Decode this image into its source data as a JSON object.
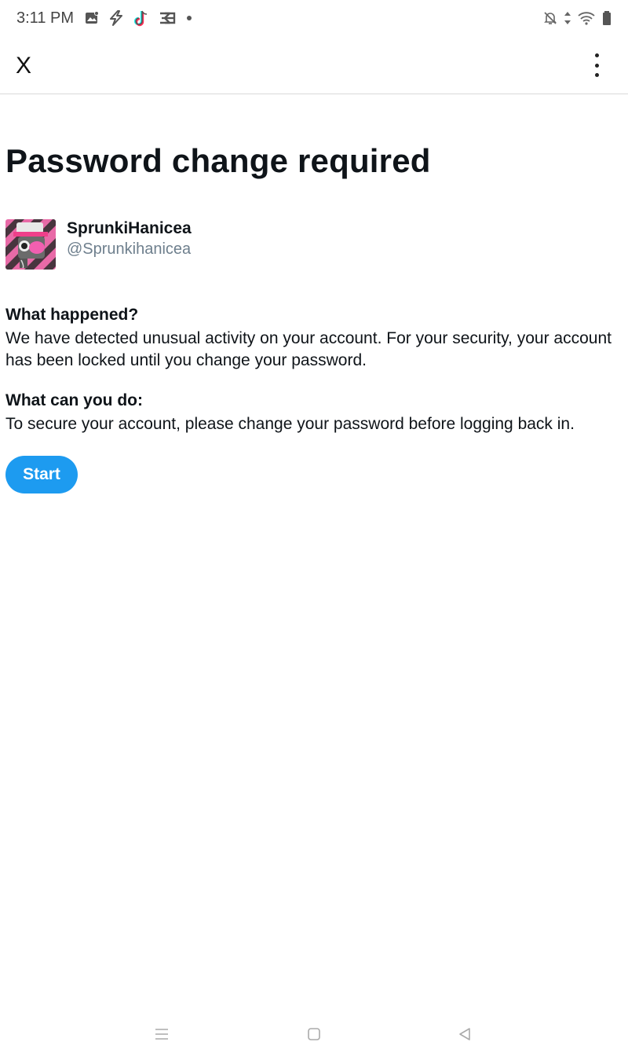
{
  "status_bar": {
    "time": "3:11 PM",
    "left_icons": [
      "gallery-icon",
      "flash-app-icon",
      "tiktok-icon",
      "capcut-icon",
      "dot-icon"
    ],
    "right_icons": [
      "notifications-off-icon",
      "data-arrows-icon",
      "wifi-icon",
      "battery-icon"
    ]
  },
  "app_bar": {
    "close_label": "X",
    "menu_icon": "more-vertical-icon"
  },
  "main": {
    "title": "Password change required",
    "account": {
      "display_name": "SprunkiHanicea",
      "handle": "@Sprunkihanicea"
    },
    "what_happened": {
      "heading": "What happened?",
      "body": "We have detected unusual activity on your account. For your security, your account has been locked until you change your password."
    },
    "what_to_do": {
      "heading": "What can you do:",
      "body": "To secure your account, please change your password before logging back in."
    },
    "start_label": "Start"
  },
  "nav_bar": {
    "icons": [
      "recents-icon",
      "home-icon",
      "back-icon"
    ]
  },
  "colors": {
    "accent": "#1d9bf0",
    "text": "#0f1419",
    "secondary_text": "#6e7f8d",
    "divider": "#d9d9d9"
  }
}
